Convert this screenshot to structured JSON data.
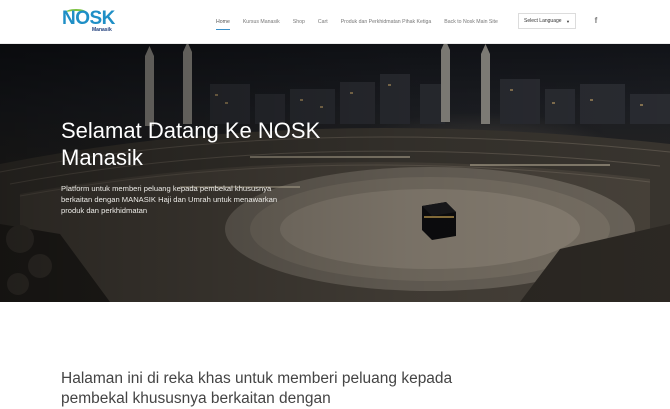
{
  "header": {
    "logo_text": "NOSK",
    "logo_sub": "Manasik",
    "nav": [
      {
        "label": "Home",
        "active": true
      },
      {
        "label": "Kursus Manasik",
        "active": false
      },
      {
        "label": "Shop",
        "active": false
      },
      {
        "label": "Cart",
        "active": false
      },
      {
        "label": "Produk dan Perkhidmatan Pihak Ketiga",
        "active": false
      },
      {
        "label": "Back to Nosk Main Site",
        "active": false
      }
    ],
    "language_select": "Select Language",
    "social_icon": "facebook-icon"
  },
  "hero": {
    "title": "Selamat Datang Ke NOSK Manasik",
    "text": "Platform untuk memberi peluang kepada pembekal khususnya berkaitan dengan MANASIK Haji dan Umrah untuk menawarkan produk dan perkhidmatan"
  },
  "intro": {
    "text": "Halaman ini di reka khas untuk memberi peluang kepada pembekal khususnya berkaitan dengan"
  },
  "colors": {
    "brand_blue": "#1f8fc6",
    "brand_green": "#7cc242",
    "nav_active_underline": "#3a8fc8"
  }
}
